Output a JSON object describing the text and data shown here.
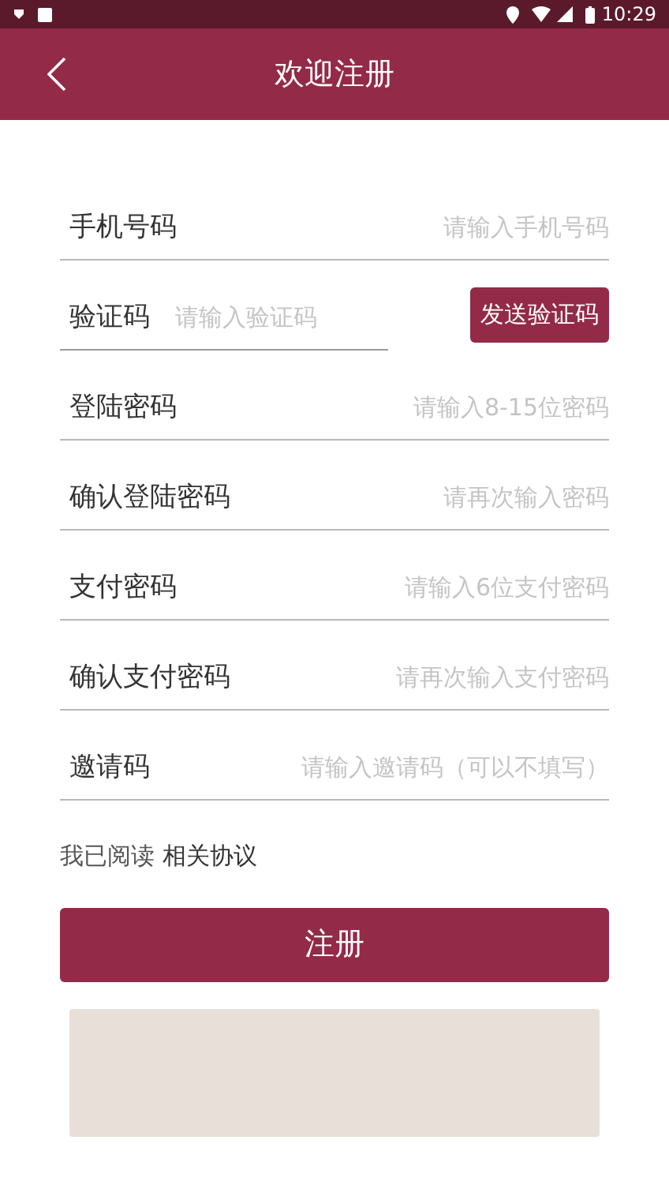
{
  "status_bar": {
    "time": "10:29"
  },
  "header": {
    "title": "欢迎注册"
  },
  "fields": [
    {
      "kind": "text",
      "label": "手机号码",
      "placeholder": "请输入手机号码"
    },
    {
      "kind": "code",
      "label": "验证码",
      "placeholder": "请输入验证码",
      "button": "发送验证码"
    },
    {
      "kind": "text",
      "label": "登陆密码",
      "placeholder": "请输入8-15位密码"
    },
    {
      "kind": "text",
      "label": "确认登陆密码",
      "placeholder": "请再次输入密码"
    },
    {
      "kind": "text",
      "label": "支付密码",
      "placeholder": "请输入6位支付密码"
    },
    {
      "kind": "text",
      "label": "确认支付密码",
      "placeholder": "请再次输入支付密码"
    },
    {
      "kind": "text",
      "label": "邀请码",
      "placeholder": "请输入邀请码（可以不填写）"
    }
  ],
  "agreement": {
    "text": "我已阅读",
    "link": "相关协议"
  },
  "submit": "注册"
}
